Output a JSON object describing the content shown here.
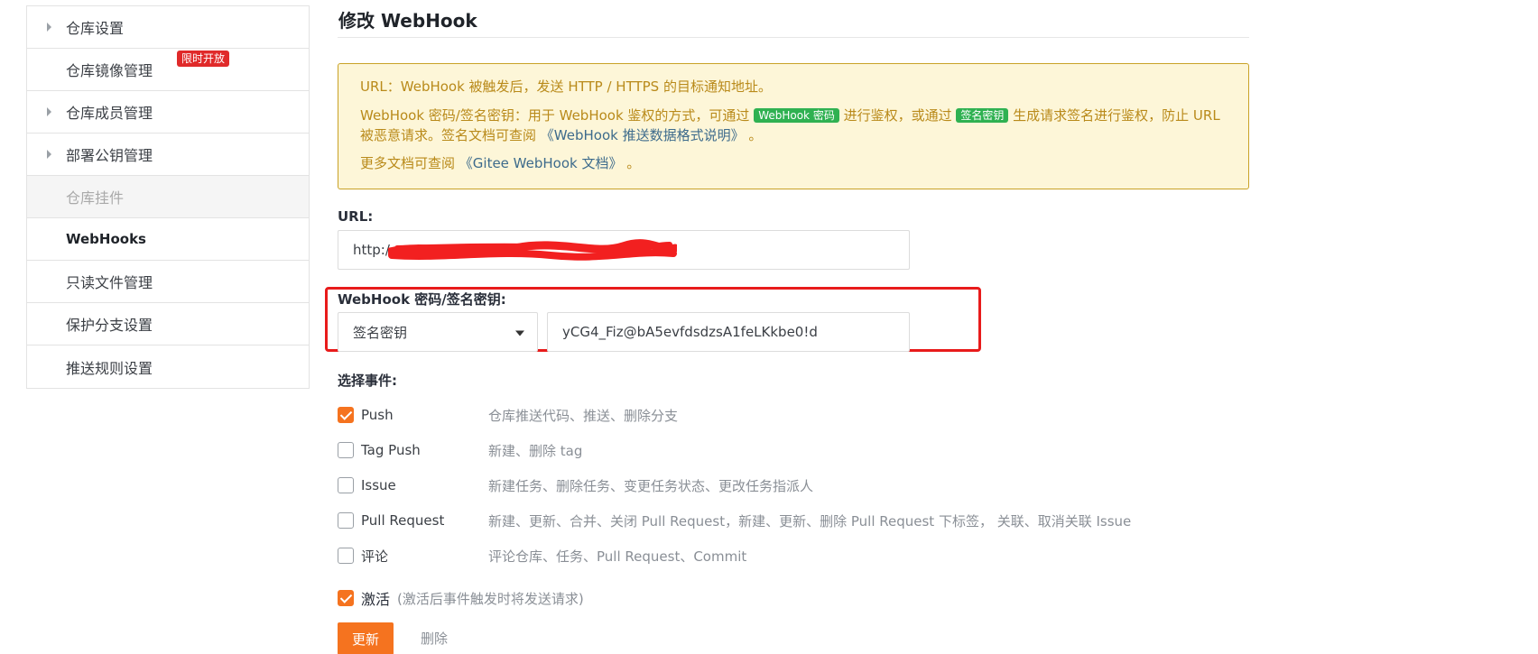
{
  "sidebar": {
    "items": [
      {
        "label": "仓库设置"
      },
      {
        "label": "仓库镜像管理",
        "badge": "限时开放"
      },
      {
        "label": "仓库成员管理"
      },
      {
        "label": "部署公钥管理"
      },
      {
        "label": "仓库挂件"
      },
      {
        "label": "WebHooks"
      },
      {
        "label": "只读文件管理"
      },
      {
        "label": "保护分支设置"
      },
      {
        "label": "推送规则设置"
      }
    ]
  },
  "main": {
    "title": "修改 WebHook",
    "notice": {
      "line1": "URL：WebHook 被触发后，发送 HTTP / HTTPS 的目标通知地址。",
      "line2_a": "WebHook 密码/签名密钥：用于 WebHook 鉴权的方式，可通过 ",
      "tag_password": "WebHook 密码",
      "line2_b": " 进行鉴权，或通过 ",
      "tag_signature": "签名密钥",
      "line2_c": " 生成请求签名进行鉴权，防止 URL 被恶意请求。签名文档可查阅 ",
      "link_push_format": "《WebHook 推送数据格式说明》",
      "line2_d": " 。",
      "line3_a": "更多文档可查阅 ",
      "link_gitee_docs": "《Gitee WebHook 文档》",
      "line3_b": " 。"
    },
    "url": {
      "label": "URL:",
      "value": "http:/"
    },
    "secret": {
      "label": "WebHook 密码/签名密钥:",
      "mode": "签名密钥",
      "value": "yCG4_Fiz@bA5evfdsdzsA1feLKkbe0!d"
    },
    "events": {
      "label": "选择事件:",
      "items": [
        {
          "name": "Push",
          "desc": "仓库推送代码、推送、删除分支",
          "checked": true
        },
        {
          "name": "Tag Push",
          "desc": "新建、删除 tag",
          "checked": false
        },
        {
          "name": "Issue",
          "desc": "新建任务、删除任务、变更任务状态、更改任务指派人",
          "checked": false
        },
        {
          "name": "Pull Request",
          "desc": "新建、更新、合并、关闭 Pull Request，新建、更新、删除 Pull Request 下标签， 关联、取消关联 Issue",
          "checked": false
        },
        {
          "name": "评论",
          "desc": "评论仓库、任务、Pull Request、Commit",
          "checked": false
        }
      ]
    },
    "activate": {
      "label": "激活",
      "hint": "(激活后事件触发时将发送请求)",
      "checked": true
    },
    "actions": {
      "update": "更新",
      "delete": "删除"
    }
  },
  "colors": {
    "accent": "#f5731f",
    "notice_bg": "#fdf6d8",
    "notice_border": "#c9a227",
    "notice_text": "#b98a1a",
    "tag_green": "#2fb151",
    "badge_red": "#e02a2a",
    "highlight_red": "#e81b1b"
  }
}
